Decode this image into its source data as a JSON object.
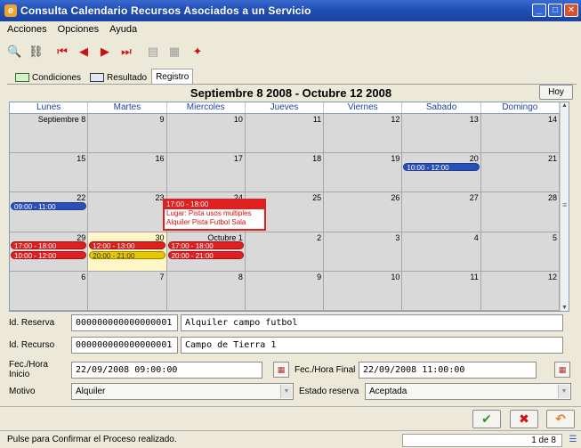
{
  "window": {
    "title": "Consulta Calendario Recursos Asociados a un Servicio"
  },
  "menu": [
    {
      "label": "Acciones"
    },
    {
      "label": "Opciones"
    },
    {
      "label": "Ayuda"
    }
  ],
  "tabs": [
    {
      "label": "Condiciones"
    },
    {
      "label": "Resultado"
    },
    {
      "label": "Registro"
    }
  ],
  "calendar": {
    "title": "Septiembre 8 2008 - Octubre 12 2008",
    "hoy_label": "Hoy",
    "weekdays": [
      "Lunes",
      "Martes",
      "Miercoles",
      "Jueves",
      "Viernes",
      "Sabado",
      "Domingo"
    ],
    "weeks": [
      [
        {
          "num": "Septiembre 8"
        },
        {
          "num": "9"
        },
        {
          "num": "10"
        },
        {
          "num": "11"
        },
        {
          "num": "12"
        },
        {
          "num": "13"
        },
        {
          "num": "14"
        }
      ],
      [
        {
          "num": "15"
        },
        {
          "num": "16"
        },
        {
          "num": "17"
        },
        {
          "num": "18"
        },
        {
          "num": "19"
        },
        {
          "num": "20"
        },
        {
          "num": "21"
        }
      ],
      [
        {
          "num": "22"
        },
        {
          "num": "23"
        },
        {
          "num": "24"
        },
        {
          "num": "25"
        },
        {
          "num": "26"
        },
        {
          "num": "27"
        },
        {
          "num": "28"
        }
      ],
      [
        {
          "num": "29"
        },
        {
          "num": "30"
        },
        {
          "num": "Octubre 1"
        },
        {
          "num": "2"
        },
        {
          "num": "3"
        },
        {
          "num": "4"
        },
        {
          "num": "5"
        }
      ],
      [
        {
          "num": "6"
        },
        {
          "num": "7"
        },
        {
          "num": "8"
        },
        {
          "num": "9"
        },
        {
          "num": "10"
        },
        {
          "num": "11"
        },
        {
          "num": "12"
        }
      ]
    ],
    "events": {
      "sat20": "10:00 - 12:00",
      "mon22": "09:00 - 11:00",
      "mon29_a": "17:00 - 18:00",
      "mon29_b": "10:00 - 12:00",
      "tue30_a": "12:00 - 13:00",
      "tue30_b": "20:00 - 21:00",
      "wed1_a": "17:00 - 18:00",
      "wed1_b": "20:00 - 21:00"
    },
    "tooltip": {
      "time": "17:00 - 18:00",
      "lugar": "Lugar: Pista usos multiples",
      "desc": "Alquiler Pista Futbol Sala"
    }
  },
  "form": {
    "id_reserva_label": "Id. Reserva",
    "id_reserva_value": "000000000000000001",
    "id_reserva_desc": "Alquiler campo futbol",
    "id_recurso_label": "Id. Recurso",
    "id_recurso_value": "000000000000000001",
    "id_recurso_desc": "Campo de Tierra 1",
    "fec_inicio_label": "Fec./Hora Inicio",
    "fec_inicio_value": "22/09/2008 09:00:00",
    "fec_final_label": "Fec./Hora Final",
    "fec_final_value": "22/09/2008 11:00:00",
    "motivo_label": "Motivo",
    "motivo_value": "Alquiler",
    "estado_label": "Estado reserva",
    "estado_value": "Aceptada"
  },
  "status": {
    "message": "Pulse para Confirmar el Proceso realizado.",
    "page": "1 de 8"
  }
}
